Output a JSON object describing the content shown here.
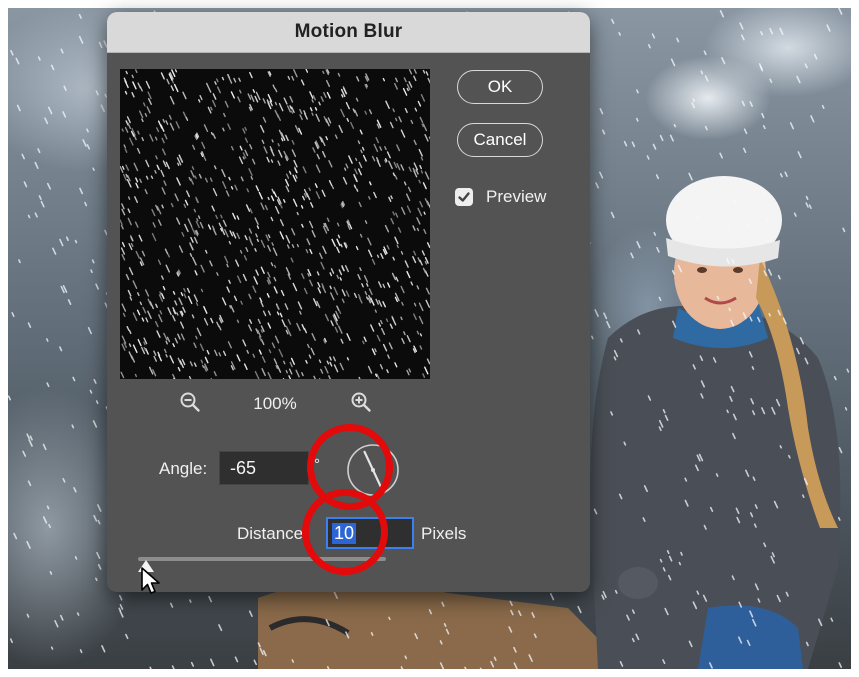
{
  "dialog": {
    "title": "Motion Blur",
    "ok_label": "OK",
    "cancel_label": "Cancel",
    "preview_label": "Preview",
    "preview_checked": true,
    "zoom_level": "100%",
    "angle_label": "Angle:",
    "angle_value": "-65",
    "degree_symbol": "°",
    "distance_label": "Distance:",
    "distance_value": "10",
    "distance_unit": "Pixels",
    "slider_level": 0.0
  },
  "icons": {
    "zoom_out": "zoom-out-icon",
    "zoom_in": "zoom-in-icon",
    "angle_dial": "angle-dial-icon",
    "checkbox": "checkmark-icon",
    "cursor": "mouse-pointer-icon"
  },
  "colors": {
    "dialog_bg": "#535353",
    "title_bg": "#d9d9d9",
    "annotation": "#e20a0a",
    "selection": "#2c66d6"
  }
}
